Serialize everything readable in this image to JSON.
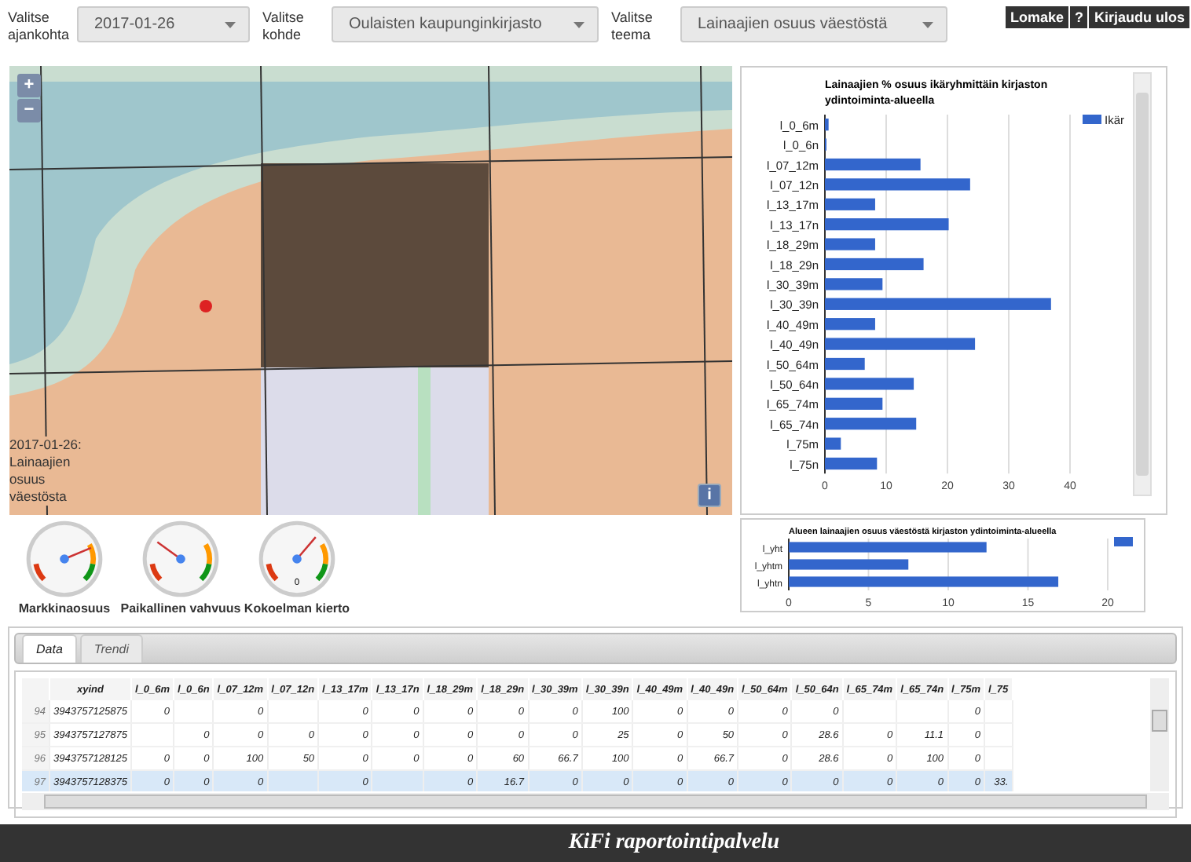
{
  "filters": [
    {
      "label": "Valitse ajankohta",
      "value": "2017-01-26"
    },
    {
      "label": "Valitse kohde",
      "value": "Oulaisten kaupunginkirjasto"
    },
    {
      "label": "Valitse teema",
      "value": "Lainaajien osuus väestöstä"
    }
  ],
  "header_buttons": [
    "Lomake",
    "?",
    "Kirjaudu ulos"
  ],
  "map": {
    "zoom_in": "+",
    "zoom_out": "−",
    "caption": "2017-01-26: Lainaajien osuus väestösta",
    "info": "i"
  },
  "age_chart": {
    "chart_data": {
      "type": "bar",
      "orientation": "horizontal",
      "title": "Lainaajien % osuus ikäryhmittäin kirjaston ydintoiminta-alueella",
      "categories": [
        "l_0_6m",
        "l_0_6n",
        "l_07_12m",
        "l_07_12n",
        "l_13_17m",
        "l_13_17n",
        "l_18_29m",
        "l_18_29n",
        "l_30_39m",
        "l_30_39n",
        "l_40_49m",
        "l_40_49n",
        "l_50_64m",
        "l_50_64n",
        "l_65_74m",
        "l_65_74n",
        "l_75m",
        "l_75n"
      ],
      "series": [
        {
          "name": "Ikär",
          "color": "#3366cc",
          "values": [
            0.6,
            0.1,
            15.6,
            23.7,
            8.2,
            20.2,
            8.2,
            16.1,
            9.4,
            36.9,
            8.2,
            24.5,
            6.5,
            14.5,
            9.4,
            14.9,
            2.6,
            8.5
          ]
        }
      ],
      "xlim": [
        0,
        40
      ],
      "xticks": [
        0,
        10,
        20,
        30,
        40
      ],
      "grid": true
    }
  },
  "total_chart": {
    "chart_data": {
      "type": "bar",
      "orientation": "horizontal",
      "title": "Alueen lainaajien osuus väestöstä kirjaston ydintoiminta-alueella",
      "categories": [
        "l_yht",
        "l_yhtm",
        "l_yhtn"
      ],
      "series": [
        {
          "color": "#3366cc",
          "values": [
            12.4,
            7.5,
            16.9
          ]
        }
      ],
      "xlim": [
        0,
        20
      ],
      "xticks": [
        0,
        5,
        10,
        15,
        20
      ],
      "grid": true
    }
  },
  "gauges": [
    {
      "label": "Markkinaosuus",
      "level": 0.75
    },
    {
      "label": "Paikallinen vahvuus",
      "level": 0.3
    },
    {
      "label": "Kokoelman kierto",
      "level": 0.65,
      "reading": "0"
    }
  ],
  "tabs": [
    {
      "label": "Data",
      "selected": true
    },
    {
      "label": "Trendi",
      "selected": false
    }
  ],
  "table": {
    "columns": [
      "xyind",
      "l_0_6m",
      "l_0_6n",
      "l_07_12m",
      "l_07_12n",
      "l_13_17m",
      "l_13_17n",
      "l_18_29m",
      "l_18_29n",
      "l_30_39m",
      "l_30_39n",
      "l_40_49m",
      "l_40_49n",
      "l_50_64m",
      "l_50_64n",
      "l_65_74m",
      "l_65_74n",
      "l_75m",
      "l_75"
    ],
    "rows": [
      {
        "number": "94",
        "selected": false,
        "cells": [
          "3943757125875",
          "0",
          null,
          "0",
          null,
          "0",
          "0",
          "0",
          "0",
          "0",
          "100",
          "0",
          "0",
          "0",
          "0",
          null,
          null,
          "0",
          null
        ]
      },
      {
        "number": "95",
        "selected": false,
        "cells": [
          "3943757127875",
          null,
          "0",
          "0",
          "0",
          "0",
          "0",
          "0",
          "0",
          "0",
          "25",
          "0",
          "50",
          "0",
          "28.6",
          "0",
          "11.1",
          "0",
          null
        ]
      },
      {
        "number": "96",
        "selected": false,
        "cells": [
          "3943757128125",
          "0",
          "0",
          "100",
          "50",
          "0",
          "0",
          "0",
          "60",
          "66.7",
          "100",
          "0",
          "66.7",
          "0",
          "28.6",
          "0",
          "100",
          "0",
          null
        ]
      },
      {
        "number": "97",
        "selected": true,
        "cells": [
          "3943757128375",
          "0",
          "0",
          "0",
          null,
          "0",
          null,
          "0",
          "16.7",
          "0",
          "0",
          "0",
          "0",
          "0",
          "0",
          "0",
          "0",
          "0",
          "33."
        ]
      }
    ]
  },
  "footer": "KiFi raportointipalvelu"
}
